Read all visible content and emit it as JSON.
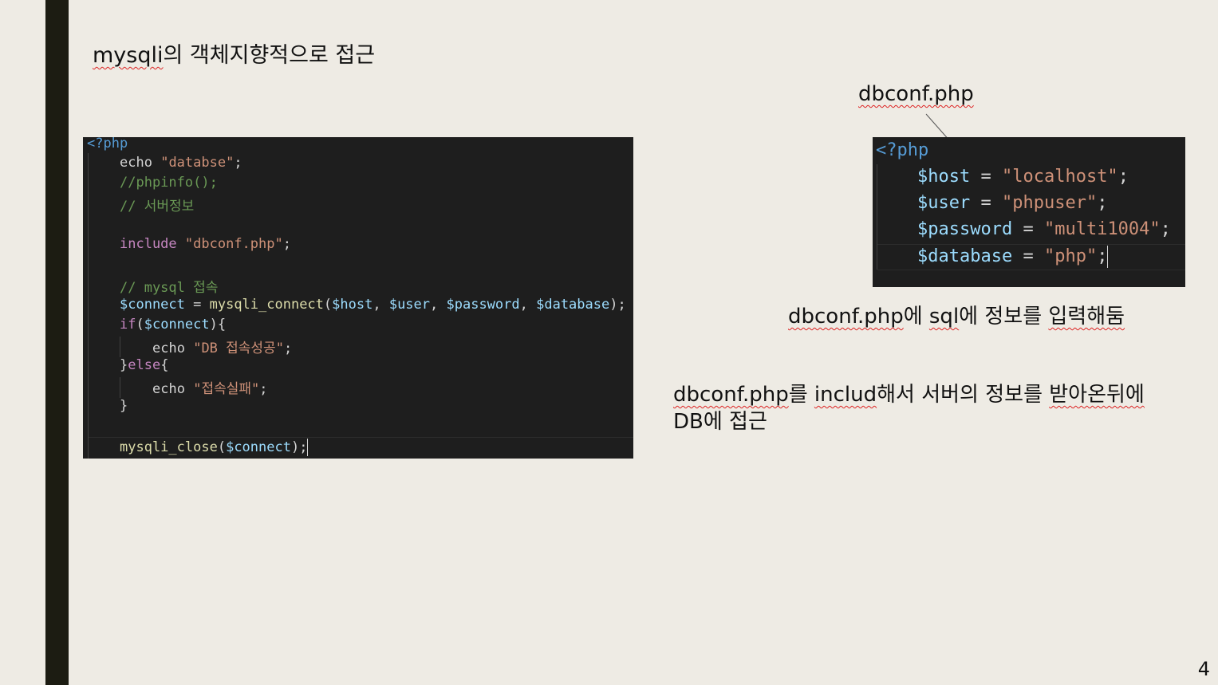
{
  "slide": {
    "title_prefix": "mysqli",
    "title_rest": "의 객체지향적으로 접근",
    "dbconf_label": "dbconf.php",
    "note1_a": "dbconf.php",
    "note1_b": "에 ",
    "note1_c": "sql",
    "note1_d": "에 정보를 ",
    "note1_e": "입력해둠",
    "note2_a": "dbconf.php",
    "note2_b": "를 ",
    "note2_c": "includ",
    "note2_d": "해서 서버의 정보를 ",
    "note2_e": "받아온뒤에",
    "note2_line2": "DB에 접근",
    "page_number": "4"
  },
  "main_code": {
    "l1": "<?php",
    "l2_kw": "echo",
    "l2_str": "\"databse\"",
    "l2_end": ";",
    "l3": "//phpinfo();",
    "l4": "// 서버정보",
    "l6_kw": "include",
    "l6_str": "\"dbconf.php\"",
    "l6_end": ";",
    "l8": "// mysql 접속",
    "l9_var": "$connect",
    "l9_eq": " = ",
    "l9_fn": "mysqli_connect",
    "l9_open": "(",
    "l9_a1": "$host",
    "l9_sep1": ", ",
    "l9_a2": "$user",
    "l9_sep2": ", ",
    "l9_a3": "$password",
    "l9_sep3": ", ",
    "l9_a4": "$database",
    "l9_close": ");",
    "l10_kw": "if",
    "l10_open": "(",
    "l10_var": "$connect",
    "l10_close": "){",
    "l11_kw": "echo",
    "l11_str": "\"DB 접속성공\"",
    "l11_end": ";",
    "l12_br": "}",
    "l12_kw": "else",
    "l12_open": "{",
    "l13_kw": "echo",
    "l13_str": "\"접속실패\"",
    "l13_end": ";",
    "l14": "}",
    "l16_fn": "mysqli_close",
    "l16_open": "(",
    "l16_var": "$connect",
    "l16_close": ");"
  },
  "conf_code": {
    "l1": "<?php",
    "l2_var": "$host",
    "l2_eq": " = ",
    "l2_str": "\"localhost\"",
    "l2_end": ";",
    "l3_var": "$user",
    "l3_eq": " = ",
    "l3_str": "\"phpuser\"",
    "l3_end": ";",
    "l4_var": "$password",
    "l4_eq": " = ",
    "l4_str": "\"multi1004\"",
    "l4_end": ";",
    "l5_var": "$database",
    "l5_eq": " = ",
    "l5_str": "\"php\"",
    "l5_end": ";"
  }
}
